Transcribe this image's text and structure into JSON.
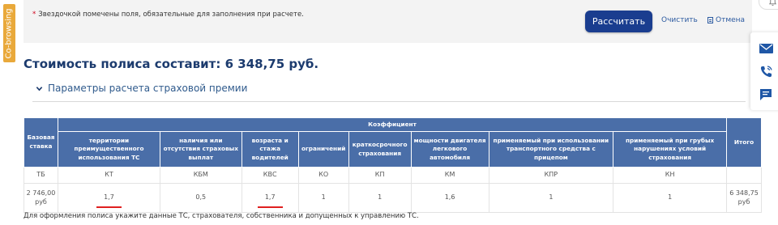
{
  "cobrowse": {
    "label": "Co-browsing"
  },
  "form": {
    "required_note_star": "*",
    "required_note": "Звездочкой помечены поля, обязательные для заполнения при расчете.",
    "calculate_label": "Рассчитать",
    "clear_label": "Очистить",
    "cancel_label": "Отмена"
  },
  "side_panel": {
    "icons": [
      "bell-icon",
      "mail-icon",
      "phone-icon",
      "chat-icon"
    ]
  },
  "result": {
    "title": "Стоимость полиса составит: 6 348,75 руб.",
    "params_label": "Параметры расчета страховой премии"
  },
  "table": {
    "base_header": "Базовая ставка",
    "coef_header": "Коэффициент",
    "total_header": "Итого",
    "columns": [
      {
        "header": "территории преимущественного использования ТС",
        "code": "КТ",
        "value": "1,7"
      },
      {
        "header": "наличия или отсутствия страховых выплат",
        "code": "КБМ",
        "value": "0,5"
      },
      {
        "header": "возраста и стажа водителей",
        "code": "КВС",
        "value": "1,7"
      },
      {
        "header": "ограничений",
        "code": "КО",
        "value": "1"
      },
      {
        "header": "краткосрочного страхования",
        "code": "КП",
        "value": "1"
      },
      {
        "header": "мощности двигателя легкового автомобиля",
        "code": "КМ",
        "value": "1,6"
      },
      {
        "header": "применяемый при использовании транспортного средства с прицепом",
        "code": "КПР",
        "value": "1"
      },
      {
        "header": "применяемый при грубых нарушениях условий страхования",
        "code": "КН",
        "value": "1"
      }
    ],
    "base_code": "ТБ",
    "base_value": "2 746,00 руб",
    "total_value": "6 348,75 руб"
  },
  "footer_note": "Для оформления полиса укажите данные ТС, страхователя, собственника и допущенных к управлению ТС.",
  "colors": {
    "brand_dark": "#1a3d8f",
    "table_header": "#4a6ea8",
    "accent_orange": "#e9a93b",
    "underline_red": "#e02020"
  }
}
